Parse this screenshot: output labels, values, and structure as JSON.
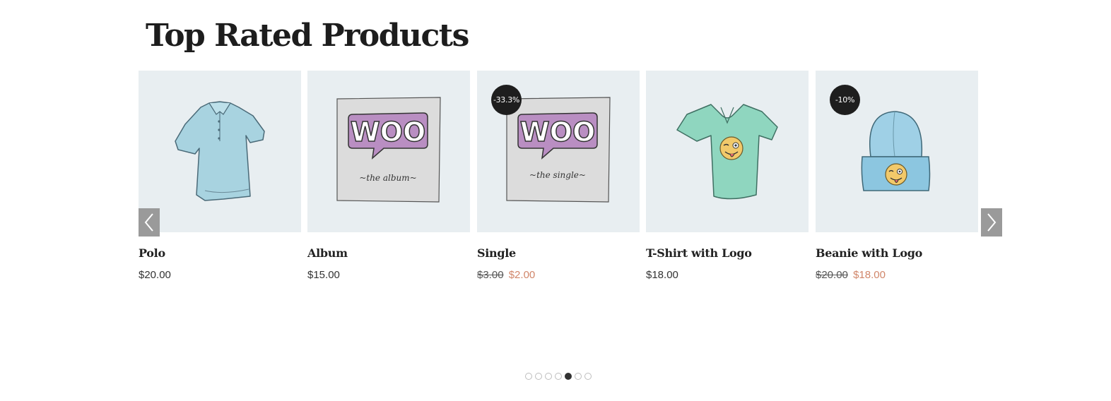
{
  "section": {
    "title": "Top Rated Products"
  },
  "products": [
    {
      "name": "Polo",
      "price": "$20.00",
      "image": "polo-shirt"
    },
    {
      "name": "Album",
      "price": "$15.00",
      "image": "woo-album",
      "art_word": "WOO",
      "art_caption": "~the album~"
    },
    {
      "name": "Single",
      "badge": "-33.3%",
      "old_price": "$3.00",
      "price": "$2.00",
      "image": "woo-single",
      "art_word": "WOO",
      "art_caption": "~the single~"
    },
    {
      "name": "T-Shirt with Logo",
      "price": "$18.00",
      "image": "tshirt-logo"
    },
    {
      "name": "Beanie with Logo",
      "badge": "-10%",
      "old_price": "$20.00",
      "price": "$18.00",
      "image": "beanie-logo"
    }
  ],
  "carousel": {
    "prev_icon": "chevron-left-icon",
    "next_icon": "chevron-right-icon",
    "dot_count": 7,
    "active_dot": 5
  },
  "colors": {
    "thumb_bg": "#e8eef1",
    "sale_price": "#d1866a",
    "badge_bg": "#1e1e1e",
    "nav_bg": "#9a9a9a"
  }
}
